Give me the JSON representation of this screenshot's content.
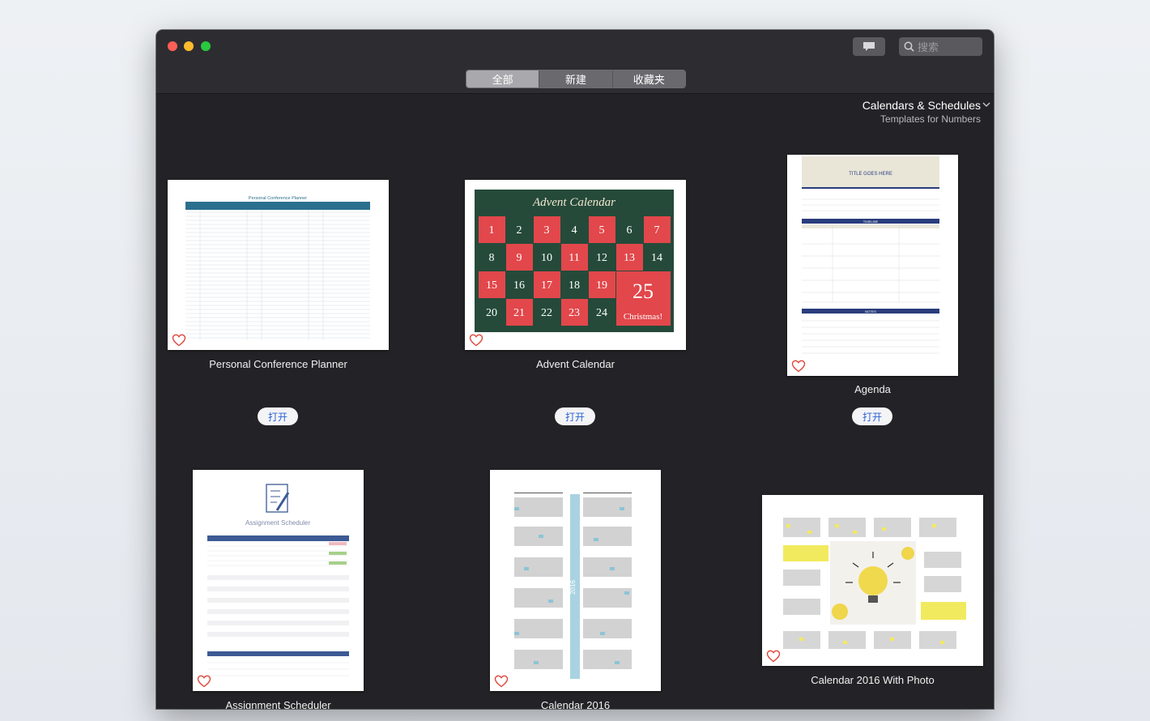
{
  "search": {
    "placeholder": "搜索"
  },
  "tabs": [
    {
      "label": "全部",
      "active": true
    },
    {
      "label": "新建",
      "active": false
    },
    {
      "label": "收藏夹",
      "active": false
    }
  ],
  "category": {
    "title": "Calendars & Schedules",
    "subtitle": "Templates for Numbers"
  },
  "open_label": "打开",
  "thumbnails": {
    "planner_title": "Personal Conference Planner",
    "advent_title": "Advent Calendar",
    "agenda_title": "TITLE GOES HERE",
    "agenda_timeline": "TIMELINE",
    "agenda_notes": "NOTES",
    "assignment_title": "Assignment Scheduler",
    "advent_days": [
      "1",
      "2",
      "3",
      "4",
      "5",
      "6",
      "7",
      "8",
      "9",
      "10",
      "11",
      "12",
      "13",
      "14",
      "15",
      "16",
      "17",
      "18",
      "19",
      "25",
      "20",
      "21",
      "22",
      "23",
      "24"
    ],
    "advent_christmas": "Christmas!",
    "cal_year": "2016"
  },
  "templates": [
    {
      "name": "Personal Conference Planner"
    },
    {
      "name": "Advent Calendar"
    },
    {
      "name": "Agenda"
    },
    {
      "name": "Assignment Scheduler"
    },
    {
      "name": "Calendar 2016"
    },
    {
      "name": "Calendar 2016 With Photo"
    }
  ],
  "colors": {
    "accent": "#2a63d4",
    "heart": "#e0453a",
    "advent_red": "#e2474b",
    "advent_green": "#254a3a"
  }
}
